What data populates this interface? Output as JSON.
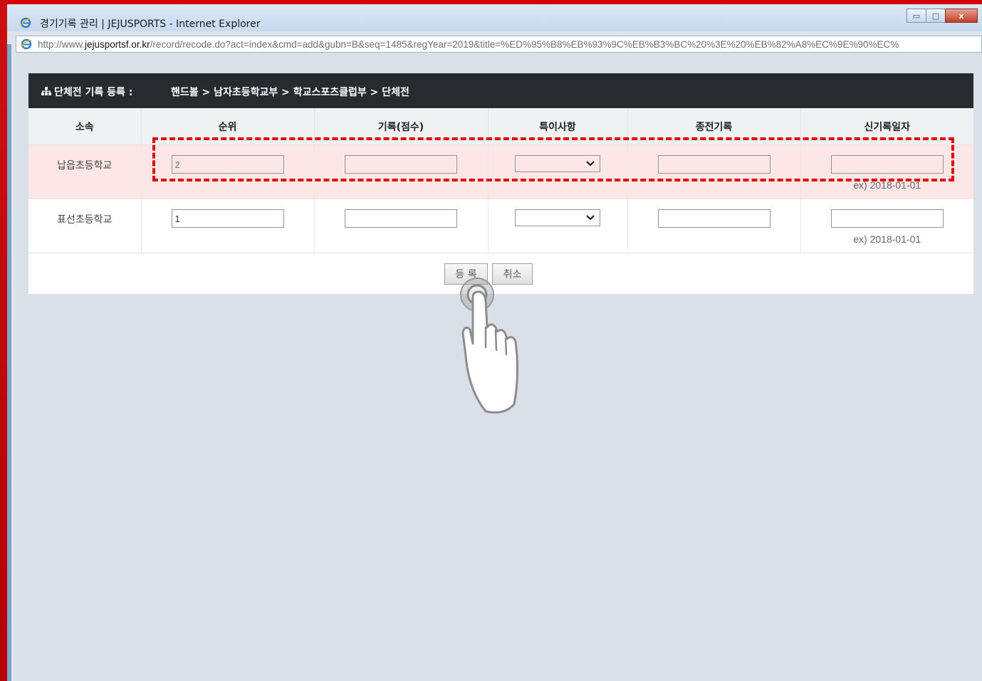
{
  "window": {
    "title": "경기기록 관리 | JEJUSPORTS - Internet Explorer",
    "controls": {
      "minimize": "▭",
      "maximize": "□",
      "close": "x"
    }
  },
  "address": {
    "prefix": "http://www.",
    "domain": "jejusportsf.or.kr",
    "path": "/record/recode.do?act=index&cmd=add&gubn=B&seq=1485&regYear=2019&title=%ED%95%B8%EB%93%9C%EB%B3%BC%20%3E%20%EB%82%A8%EC%9E%90%EC%"
  },
  "panel": {
    "title": "단체전 기록 등록 :",
    "breadcrumb": "핸드볼 > 남자초등학교부 > 학교스포츠클럽부 > 단체전"
  },
  "table": {
    "headers": [
      "소속",
      "순위",
      "기록(점수)",
      "특이사항",
      "종전기록",
      "신기록일자"
    ],
    "rows": [
      {
        "school": "납읍초등학교",
        "rank": "2",
        "score": "",
        "note": "",
        "prev": "",
        "date": "",
        "date_hint": "ex) 2018-01-01"
      },
      {
        "school": "표선초등학교",
        "rank": "1",
        "score": "",
        "note": "",
        "prev": "",
        "date": "",
        "date_hint": "ex) 2018-01-01"
      }
    ]
  },
  "buttons": {
    "register": "등 록",
    "cancel": "취소"
  },
  "colors": {
    "highlight": "#e00000",
    "header_bg": "#272b30",
    "row_highlight": "#fde6e6"
  },
  "icons": {
    "browser": "ie-icon",
    "panel": "sitemap-icon",
    "pointer": "hand-pointer-icon"
  }
}
